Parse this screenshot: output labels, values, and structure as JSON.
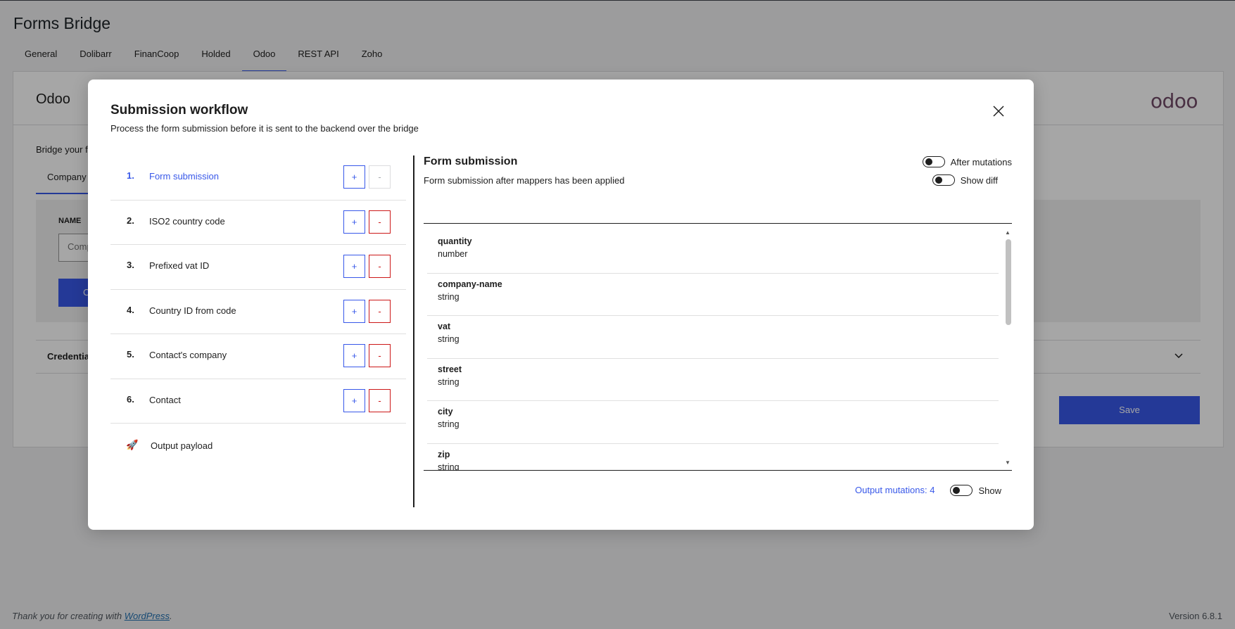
{
  "page": {
    "title": "Forms Bridge",
    "tabs": [
      "General",
      "Dolibarr",
      "FinanCoop",
      "Holded",
      "Odoo",
      "REST API",
      "Zoho"
    ],
    "active_tab": "Odoo"
  },
  "panel": {
    "title": "Odoo",
    "logo": "odoo",
    "description": "Bridge your f",
    "subtab": "Company",
    "name_label": "NAME",
    "name_value": "Comp",
    "blue_button": "C",
    "credentials_label": "Credential",
    "save_label": "Save"
  },
  "footer": {
    "thanks_prefix": "Thank you for creating with ",
    "thanks_link": "WordPress",
    "thanks_suffix": ".",
    "version": "Version 6.8.1"
  },
  "modal": {
    "title": "Submission workflow",
    "description": "Process the form submission before it is sent to the backend over the bridge",
    "close_icon": "close-icon",
    "steps": [
      {
        "num": "1.",
        "label": "Form submission",
        "active": true,
        "add": "+",
        "remove": "-"
      },
      {
        "num": "2.",
        "label": "ISO2 country code",
        "active": false,
        "add": "+",
        "remove": "-"
      },
      {
        "num": "3.",
        "label": "Prefixed vat ID",
        "active": false,
        "add": "+",
        "remove": "-"
      },
      {
        "num": "4.",
        "label": "Country ID from code",
        "active": false,
        "add": "+",
        "remove": "-"
      },
      {
        "num": "5.",
        "label": "Contact's company",
        "active": false,
        "add": "+",
        "remove": "-"
      },
      {
        "num": "6.",
        "label": "Contact",
        "active": false,
        "add": "+",
        "remove": "-"
      }
    ],
    "output": {
      "icon": "🚀",
      "label": "Output payload"
    },
    "detail": {
      "title": "Form submission",
      "subtitle": "Form submission after mappers has been applied",
      "toggle_after_mutations": "After mutations",
      "toggle_show_diff": "Show diff",
      "fields": [
        {
          "name": "quantity",
          "type": "number"
        },
        {
          "name": "company-name",
          "type": "string"
        },
        {
          "name": "vat",
          "type": "string"
        },
        {
          "name": "street",
          "type": "string"
        },
        {
          "name": "city",
          "type": "string"
        },
        {
          "name": "zip",
          "type": "string"
        }
      ],
      "output_mutations": "Output mutations: 4",
      "toggle_show": "Show"
    }
  },
  "colors": {
    "accent": "#3858e9",
    "danger": "#cc1818",
    "odoo_logo": "#714b67"
  }
}
